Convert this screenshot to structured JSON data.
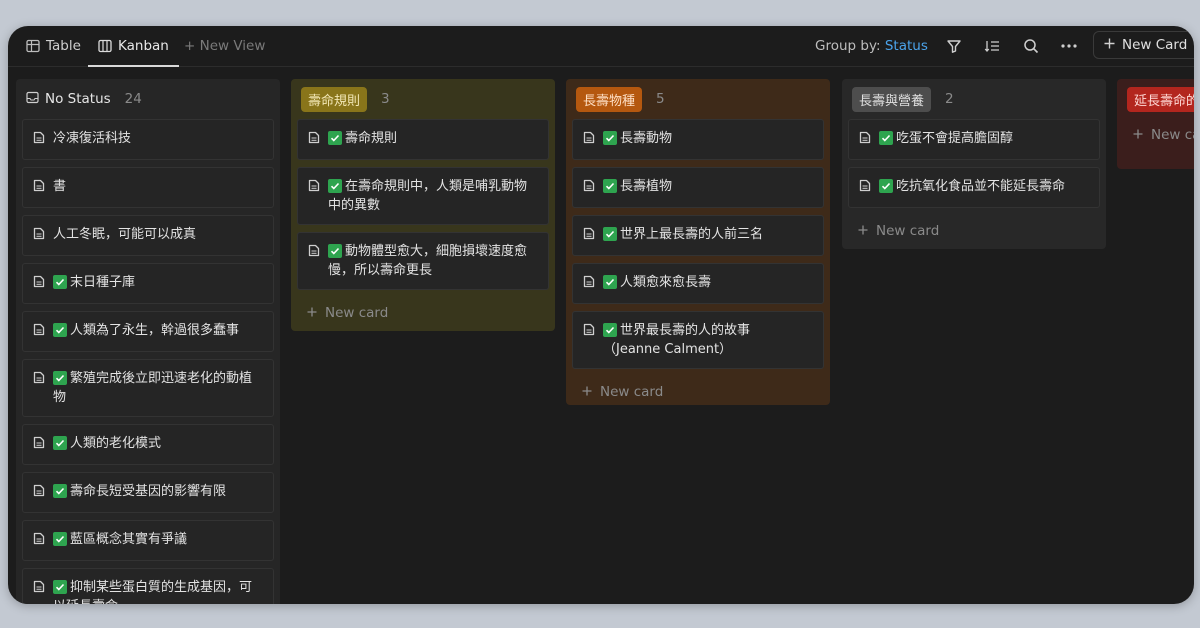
{
  "tabs": [
    {
      "label": "Table",
      "icon": "table-icon"
    },
    {
      "label": "Kanban",
      "icon": "kanban-icon"
    },
    {
      "label": "+ New View",
      "icon": "plus-icon"
    }
  ],
  "toolbar": {
    "group_by_label": "Group by:",
    "group_by_value": "Status",
    "new_card_label": "New Card"
  },
  "columns": [
    {
      "title": "No Status",
      "count": "24",
      "cards": [
        {
          "text": "冷凍復活科技",
          "checked": false
        },
        {
          "text": "書",
          "checked": false
        },
        {
          "text": "人工冬眠，可能可以成真",
          "checked": false
        },
        {
          "text": "末日種子庫",
          "checked": true
        },
        {
          "text": "人類為了永生，幹過很多蠢事",
          "checked": true
        },
        {
          "text": "繁殖完成後立即迅速老化的動植物",
          "checked": true
        },
        {
          "text": "人類的老化模式",
          "checked": true
        },
        {
          "text": "壽命長短受基因的影響有限",
          "checked": true
        },
        {
          "text": "藍區概念其實有爭議",
          "checked": true
        },
        {
          "text": "抑制某些蛋白質的生成基因，可以延長壽命",
          "checked": true
        }
      ]
    },
    {
      "title": "壽命規則",
      "count": "3",
      "pill_bg": "#89751a",
      "col_bg": "#38361c",
      "pill_fg": "#f2e7b5",
      "new_card": "New card",
      "cards": [
        {
          "text": "壽命規則",
          "checked": true
        },
        {
          "text": "在壽命規則中，人類是哺乳動物中的異數",
          "checked": true
        },
        {
          "text": "動物體型愈大，細胞損壞速度愈慢，所以壽命更長",
          "checked": true
        }
      ]
    },
    {
      "title": "長壽物種",
      "count": "5",
      "pill_bg": "#b5580f",
      "col_bg": "#3e2a19",
      "pill_fg": "#ffe0c6",
      "new_card": "New card",
      "cards": [
        {
          "text": "長壽動物",
          "checked": true
        },
        {
          "text": "長壽植物",
          "checked": true
        },
        {
          "text": "世界上最長壽的人前三名",
          "checked": true
        },
        {
          "text": "人類愈來愈長壽",
          "checked": true
        },
        {
          "text": "世界最長壽的人的故事（Jeanne Calment）",
          "checked": true
        }
      ]
    },
    {
      "title": "長壽與營養",
      "count": "2",
      "pill_bg": "#4d4d4d",
      "col_bg": "#282828",
      "pill_fg": "#e0e0e0",
      "new_card": "New card",
      "cards": [
        {
          "text": "吃蛋不會提高膽固醇",
          "checked": true
        },
        {
          "text": "吃抗氧化食品並不能延長壽命",
          "checked": true
        }
      ]
    },
    {
      "title": "延長壽命的方法",
      "count": "",
      "pill_bg": "#b3261e",
      "col_bg": "#3b1e1c",
      "pill_fg": "#ffd9d6",
      "new_card": "New card",
      "cards": []
    }
  ],
  "colors": {
    "accent": "#4ba3ea",
    "check_green": "#2ea44f",
    "background": "#1c1c1c"
  }
}
